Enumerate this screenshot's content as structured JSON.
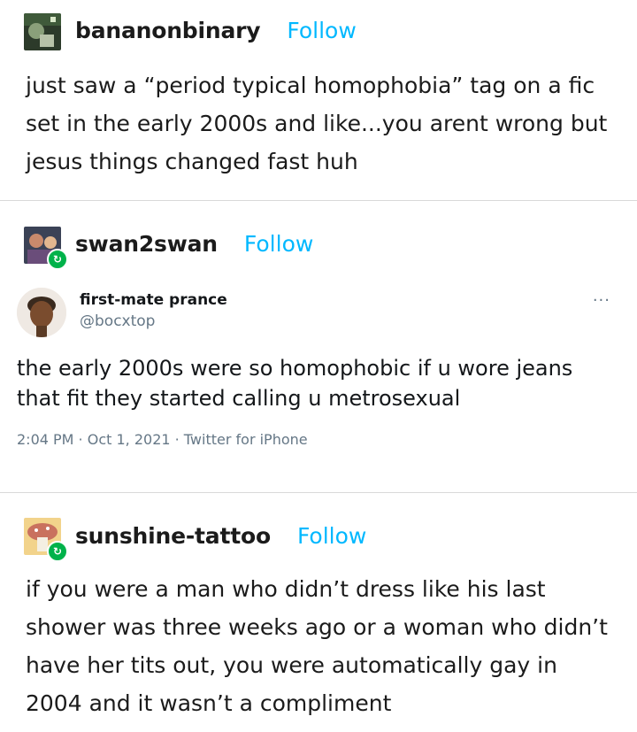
{
  "posts": [
    {
      "username": "bananonbinary",
      "follow_label": "Follow",
      "text": "just saw a “period typical homophobia” tag on a fic set in the early 2000s and like...you arent wrong but jesus things changed fast huh"
    },
    {
      "username": "swan2swan",
      "follow_label": "Follow",
      "tweet": {
        "display_name": "first-mate prance",
        "handle": "@bocxtop",
        "more_icon": "···",
        "text": "the early 2000s were so homophobic if u wore jeans that fit they started calling u metrosexual",
        "meta": "2:04 PM · Oct 1, 2021 · Twitter for iPhone"
      }
    },
    {
      "username": "sunshine-tattoo",
      "follow_label": "Follow",
      "text": "if you were a man who didn’t dress like his last shower was three weeks ago or a woman who didn’t have her tits out, you were automatically gay in 2004 and it wasn’t a compliment"
    }
  ],
  "colors": {
    "follow": "#00b8ff",
    "reblog_badge": "#00b24a",
    "divider": "#d9d9d9"
  },
  "icons": {
    "reblog": "↻"
  }
}
